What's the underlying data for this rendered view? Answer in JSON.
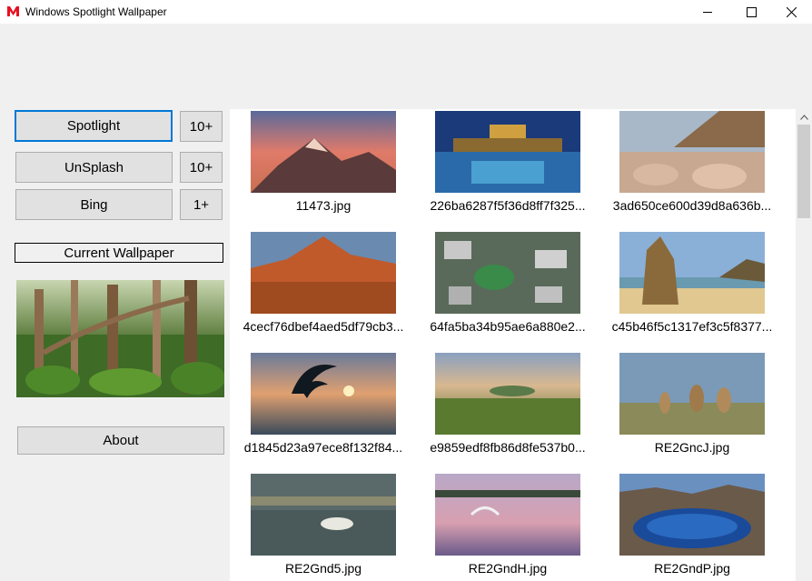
{
  "window": {
    "title": "Windows Spotlight Wallpaper",
    "controls": [
      "minimize-icon",
      "maximize-icon",
      "close-icon"
    ]
  },
  "sources": [
    {
      "label": "Spotlight",
      "count": "10+",
      "focused": true
    },
    {
      "label": "UnSplash",
      "count": "10+",
      "focused": false
    },
    {
      "label": "Bing",
      "count": "1+",
      "focused": false
    }
  ],
  "current_wallpaper_label": "Current Wallpaper",
  "about_label": "About",
  "gallery": {
    "items": [
      {
        "caption": "11473.jpg"
      },
      {
        "caption": "226ba6287f5f36d8ff7f325..."
      },
      {
        "caption": "3ad650ce600d39d8a636b..."
      },
      {
        "caption": "4cecf76dbef4aed5df79cb3..."
      },
      {
        "caption": "64fa5ba34b95ae6a880e2..."
      },
      {
        "caption": "c45b46f5c1317ef3c5f8377..."
      },
      {
        "caption": "d1845d23a97ece8f132f84..."
      },
      {
        "caption": "e9859edf8fb86d8fe537b0..."
      },
      {
        "caption": "RE2GncJ.jpg"
      },
      {
        "caption": "RE2Gnd5.jpg"
      },
      {
        "caption": "RE2GndH.jpg"
      },
      {
        "caption": "RE2GndP.jpg"
      }
    ]
  },
  "colors": {
    "accent": "#0078d7",
    "button_bg": "#e1e1e1",
    "app_icon": "#e81123"
  }
}
